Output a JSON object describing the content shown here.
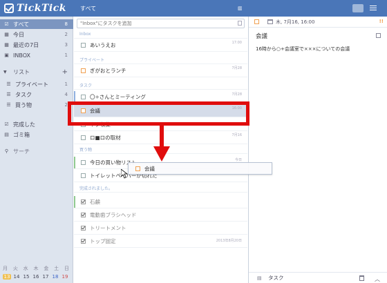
{
  "app": {
    "logo_text": "TickTick",
    "top_title": "すべて"
  },
  "sidebar": {
    "smart_lists": [
      {
        "label": "すべて",
        "count": "8",
        "icon": "all-icon"
      },
      {
        "label": "今日",
        "count": "2",
        "icon": "today-icon"
      },
      {
        "label": "最近の7日",
        "count": "3",
        "icon": "week-icon"
      },
      {
        "label": "INBOX",
        "count": "1",
        "icon": "inbox-icon"
      }
    ],
    "lists_header": "リスト",
    "lists": [
      {
        "label": "プライベート",
        "count": "1"
      },
      {
        "label": "タスク",
        "count": "4"
      },
      {
        "label": "買う物",
        "count": "2"
      }
    ],
    "completed": "完成した",
    "trash": "ゴミ箱",
    "search": "サーチ"
  },
  "calendar": {
    "weekdays": [
      "月",
      "火",
      "水",
      "木",
      "金",
      "土",
      "日"
    ],
    "days": [
      "13",
      "14",
      "15",
      "16",
      "17",
      "18",
      "19"
    ]
  },
  "list": {
    "add_placeholder": "\"Inbox\"にタスクを追加",
    "groups": [
      {
        "name": "Inbox",
        "tasks": [
          {
            "title": "あいうえお",
            "meta": "17:00"
          }
        ]
      },
      {
        "name": "プライベート",
        "tasks": [
          {
            "title": "ぎがおとランチ",
            "meta": "7月28"
          }
        ]
      },
      {
        "name": "タスク",
        "tasks": [
          {
            "title": "〇÷さんとミーティング",
            "meta": "7月28"
          },
          {
            "title": "会議",
            "meta": "16:00"
          },
          {
            "title": "ネタ収集",
            "meta": ""
          },
          {
            "title": "ロ■ロの取材",
            "meta": "7月16"
          }
        ]
      },
      {
        "name": "買う物",
        "tasks": [
          {
            "title": "今日の買い物リスト",
            "meta": "今日"
          },
          {
            "title": "トイレットペーパーが切れた",
            "meta": ""
          }
        ]
      }
    ],
    "completed_header": "完成されました。",
    "completed_tasks": [
      {
        "title": "石鹸",
        "meta": ""
      },
      {
        "title": "電動歯ブラシヘッド",
        "meta": ""
      },
      {
        "title": "トリートメント",
        "meta": ""
      },
      {
        "title": "トップ固定",
        "meta": "2013年8月20日"
      }
    ]
  },
  "drag_ghost": {
    "title": "会議"
  },
  "detail": {
    "date": "木, 7月16, 16:00",
    "priority": "!!",
    "title": "会議",
    "content": "16時から○+会議室で×××についての会議",
    "list_name": "タスク"
  },
  "colors": {
    "accent": "#4a76b8",
    "highlight": "#e00d0d",
    "priority": "#f0a050"
  }
}
